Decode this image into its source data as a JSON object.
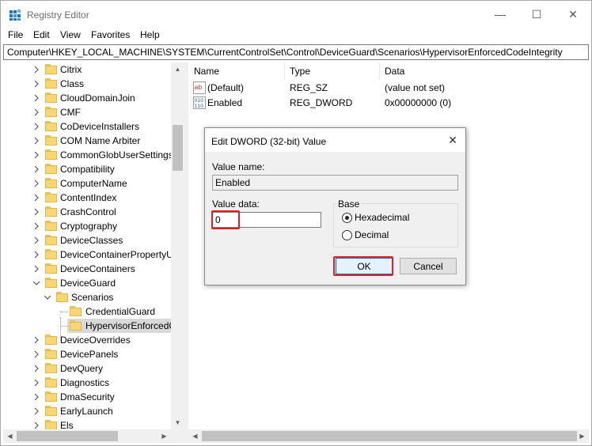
{
  "window": {
    "title": "Registry Editor",
    "minimize_glyph": "—",
    "maximize_glyph": "☐",
    "close_glyph": "✕"
  },
  "menu": [
    "File",
    "Edit",
    "View",
    "Favorites",
    "Help"
  ],
  "address": "Computer\\HKEY_LOCAL_MACHINE\\SYSTEM\\CurrentControlSet\\Control\\DeviceGuard\\Scenarios\\HypervisorEnforcedCodeIntegrity",
  "tree": {
    "items": [
      {
        "label": "Citrix",
        "depth": 0,
        "expandable": true
      },
      {
        "label": "Class",
        "depth": 0,
        "expandable": true
      },
      {
        "label": "CloudDomainJoin",
        "depth": 0,
        "expandable": true
      },
      {
        "label": "CMF",
        "depth": 0,
        "expandable": true
      },
      {
        "label": "CoDeviceInstallers",
        "depth": 0,
        "expandable": true
      },
      {
        "label": "COM Name Arbiter",
        "depth": 0,
        "expandable": true
      },
      {
        "label": "CommonGlobUserSettings",
        "depth": 0,
        "expandable": true
      },
      {
        "label": "Compatibility",
        "depth": 0,
        "expandable": true
      },
      {
        "label": "ComputerName",
        "depth": 0,
        "expandable": true
      },
      {
        "label": "ContentIndex",
        "depth": 0,
        "expandable": true
      },
      {
        "label": "CrashControl",
        "depth": 0,
        "expandable": true
      },
      {
        "label": "Cryptography",
        "depth": 0,
        "expandable": true
      },
      {
        "label": "DeviceClasses",
        "depth": 0,
        "expandable": true
      },
      {
        "label": "DeviceContainerPropertyU",
        "depth": 0,
        "expandable": true
      },
      {
        "label": "DeviceContainers",
        "depth": 0,
        "expandable": true
      },
      {
        "label": "DeviceGuard",
        "depth": 0,
        "expandable": true,
        "expanded": true
      },
      {
        "label": "Scenarios",
        "depth": 1,
        "expandable": true,
        "expanded": true
      },
      {
        "label": "CredentialGuard",
        "depth": 2,
        "expandable": false
      },
      {
        "label": "HypervisorEnforcedC",
        "depth": 2,
        "expandable": false,
        "selected": true
      },
      {
        "label": "DeviceOverrides",
        "depth": 0,
        "expandable": true
      },
      {
        "label": "DevicePanels",
        "depth": 0,
        "expandable": true
      },
      {
        "label": "DevQuery",
        "depth": 0,
        "expandable": true
      },
      {
        "label": "Diagnostics",
        "depth": 0,
        "expandable": true
      },
      {
        "label": "DmaSecurity",
        "depth": 0,
        "expandable": true
      },
      {
        "label": "EarlyLaunch",
        "depth": 0,
        "expandable": true
      },
      {
        "label": "Els",
        "depth": 0,
        "expandable": true
      }
    ]
  },
  "list": {
    "columns": [
      "Name",
      "Type",
      "Data"
    ],
    "rows": [
      {
        "name": "(Default)",
        "type": "REG_SZ",
        "data": "(value not set)",
        "icon": "string-value-icon"
      },
      {
        "name": "Enabled",
        "type": "REG_DWORD",
        "data": "0x00000000 (0)",
        "icon": "binary-value-icon"
      }
    ]
  },
  "dialog": {
    "title": "Edit DWORD (32-bit) Value",
    "value_name_label": "Value name:",
    "value_name": "Enabled",
    "value_data_label": "Value data:",
    "value_data": "0",
    "base_label": "Base",
    "base_options": [
      {
        "label": "Hexadecimal",
        "selected": true
      },
      {
        "label": "Decimal",
        "selected": false
      }
    ],
    "ok_label": "OK",
    "cancel_label": "Cancel",
    "close_glyph": "✕"
  },
  "colors": {
    "highlight": "#e02020",
    "folder": "#f7d675",
    "selected_row": "#d9d9d9"
  }
}
